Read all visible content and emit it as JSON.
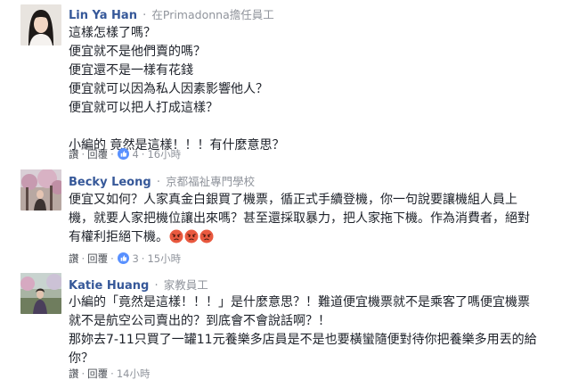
{
  "comments": [
    {
      "name": "Lin Ya Han",
      "role": "在Primadonna擔任員工",
      "lines": [
        "這樣怎樣了嗎？",
        "便宜就不是他們賣的嗎？",
        "便宜還不是一樣有花錢",
        "便宜就可以因為私人因素影響他人？",
        "便宜就可以把人打成這樣？",
        "",
        "小編的 竟然是這樣！！！有什麼意思？"
      ],
      "actions": {
        "like": "讚",
        "reply": "回覆",
        "likes_count": "4",
        "time": "16小時"
      }
    },
    {
      "name": "Becky Leong",
      "role": "京都福祉專門學校",
      "lines": [
        "便宜又如何？人家真金白銀買了機票，循正式手續登機，你一句說要讓機組人員上",
        "機，就要人家把機位讓出來嗎？甚至還採取暴力，把人家拖下機。作為消費者，絕對",
        "有權利拒絕下機。"
      ],
      "emoji_name": "angry-emoji",
      "actions": {
        "like": "讚",
        "reply": "回覆",
        "likes_count": "3",
        "time": "15小時"
      }
    },
    {
      "name": "Katie Huang",
      "role": "家教員工",
      "lines": [
        "小編的「竟然是這樣！！！」是什麼意思？！難道便宜機票就不是乘客了嗎便宜機票",
        "就不是航空公司賣出的？到底會不會說話啊？！",
        "那妳去7-11只買了一罐11元養樂多店員是不是也要橫蠻隨便對待你把養樂多用丟的給",
        "你？"
      ],
      "actions": {
        "like": "讚",
        "reply": "回覆",
        "time": "14小時"
      }
    }
  ],
  "colors": {
    "name": "#365899",
    "meta": "#90949c",
    "text": "#1d2129",
    "like_blue": "#5890ff",
    "angry": "#e9593f"
  }
}
